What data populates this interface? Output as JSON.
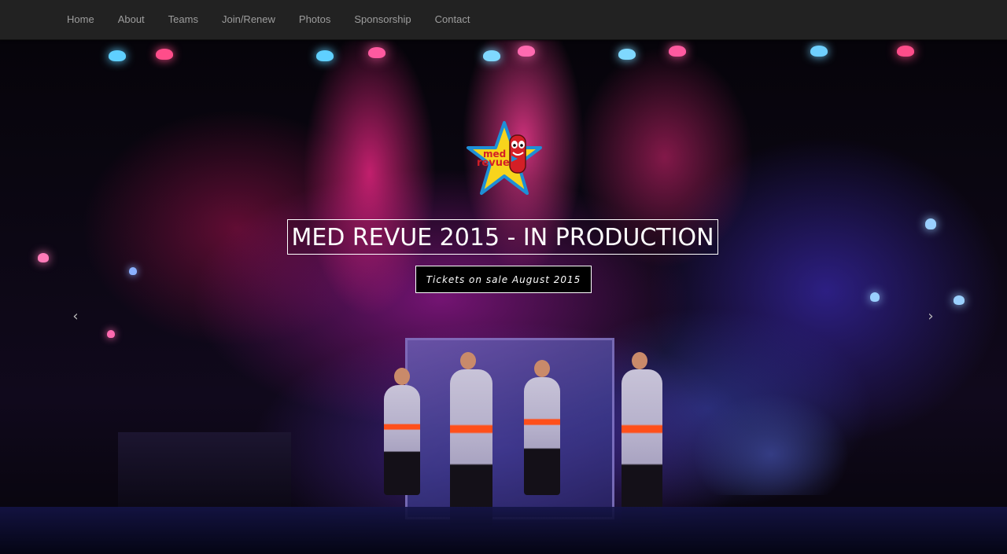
{
  "nav": {
    "items": [
      {
        "label": "Home"
      },
      {
        "label": "About"
      },
      {
        "label": "Teams"
      },
      {
        "label": "Join/Renew"
      },
      {
        "label": "Photos"
      },
      {
        "label": "Sponsorship"
      },
      {
        "label": "Contact"
      }
    ]
  },
  "hero": {
    "logo": {
      "line1": "med",
      "line2": "revue",
      "icon": "star-mascot-logo"
    },
    "title": "MED REVUE 2015 - IN PRODUCTION",
    "button_label": "Tickets on sale August 2015",
    "prev_icon": "chevron-left-icon",
    "next_icon": "chevron-right-icon",
    "colors": {
      "navbar": "#222222",
      "nav_text": "#9d9d9d",
      "caption_border": "#ffffff",
      "logo_star": "#f7d41c",
      "logo_outline": "#1e8fd6",
      "logo_text": "#d41f26"
    }
  }
}
